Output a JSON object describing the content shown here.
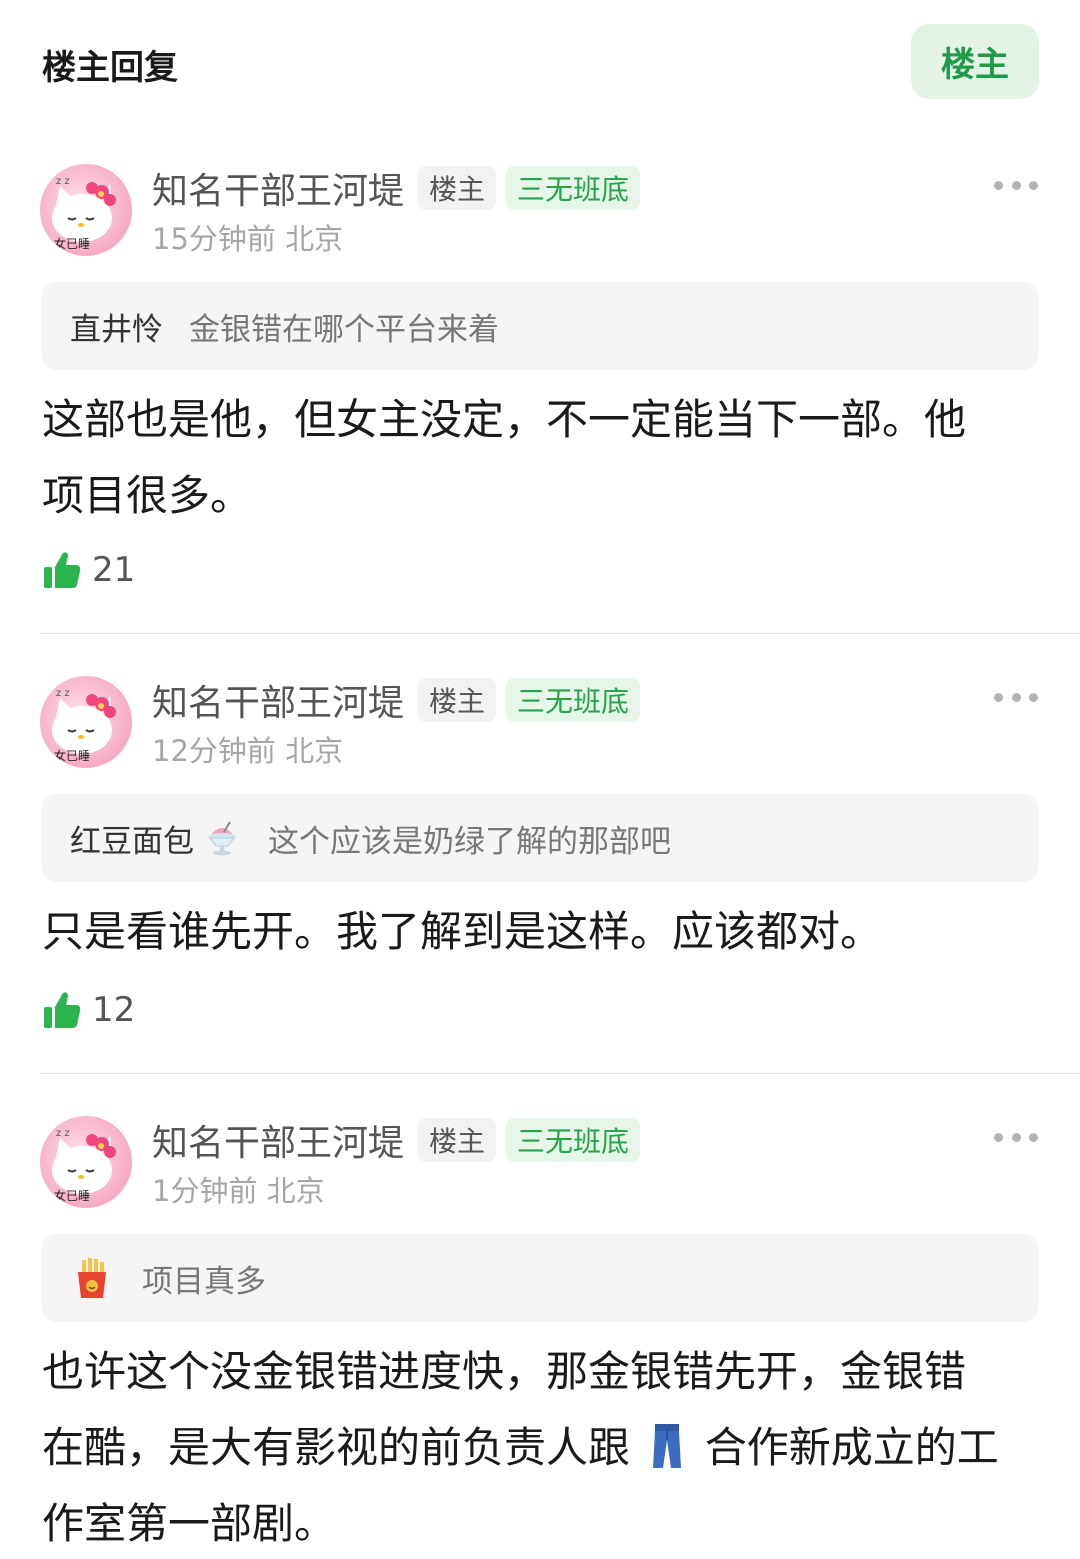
{
  "header": {
    "title": "楼主回复",
    "filter_button": "楼主"
  },
  "comments": [
    {
      "avatar_caption": "女已睡",
      "username": "知名干部王河堤",
      "op_tag": "楼主",
      "rank_tag": "三无班底",
      "meta": "15分钟前 北京",
      "quote": {
        "user": "直井怜",
        "text": "金银错在哪个平台来着",
        "icon": null
      },
      "body_lines": [
        "这部也是他，但女主没定，不一定能当下一部。他",
        "项目很多。"
      ],
      "likes": "21"
    },
    {
      "avatar_caption": "女已睡",
      "username": "知名干部王河堤",
      "op_tag": "楼主",
      "rank_tag": "三无班底",
      "meta": "12分钟前 北京",
      "quote": {
        "user": "红豆面包",
        "text": "这个应该是奶绿了解的那部吧",
        "icon": "shaved-ice-icon"
      },
      "body_lines": [
        "只是看谁先开。我了解到是这样。应该都对。"
      ],
      "likes": "12"
    },
    {
      "avatar_caption": "女已睡",
      "username": "知名干部王河堤",
      "op_tag": "楼主",
      "rank_tag": "三无班底",
      "meta": "1分钟前 北京",
      "quote": {
        "user": "",
        "text": "项目真多",
        "icon": "fries-avatar-icon"
      },
      "body_lines": [
        "也许这个没金银错进度快，那金银错先开，金银错",
        "在酷，是大有影视的前负责人跟",
        "合作新成立的工",
        "作室第一部剧。"
      ],
      "inline_icon": "jeans-icon",
      "likes": ""
    }
  ],
  "colors": {
    "accent_green": "#1f9a45",
    "tag_green": "#22a447",
    "quote_bg": "#f5f5f5",
    "like_green": "#2bb34d"
  }
}
